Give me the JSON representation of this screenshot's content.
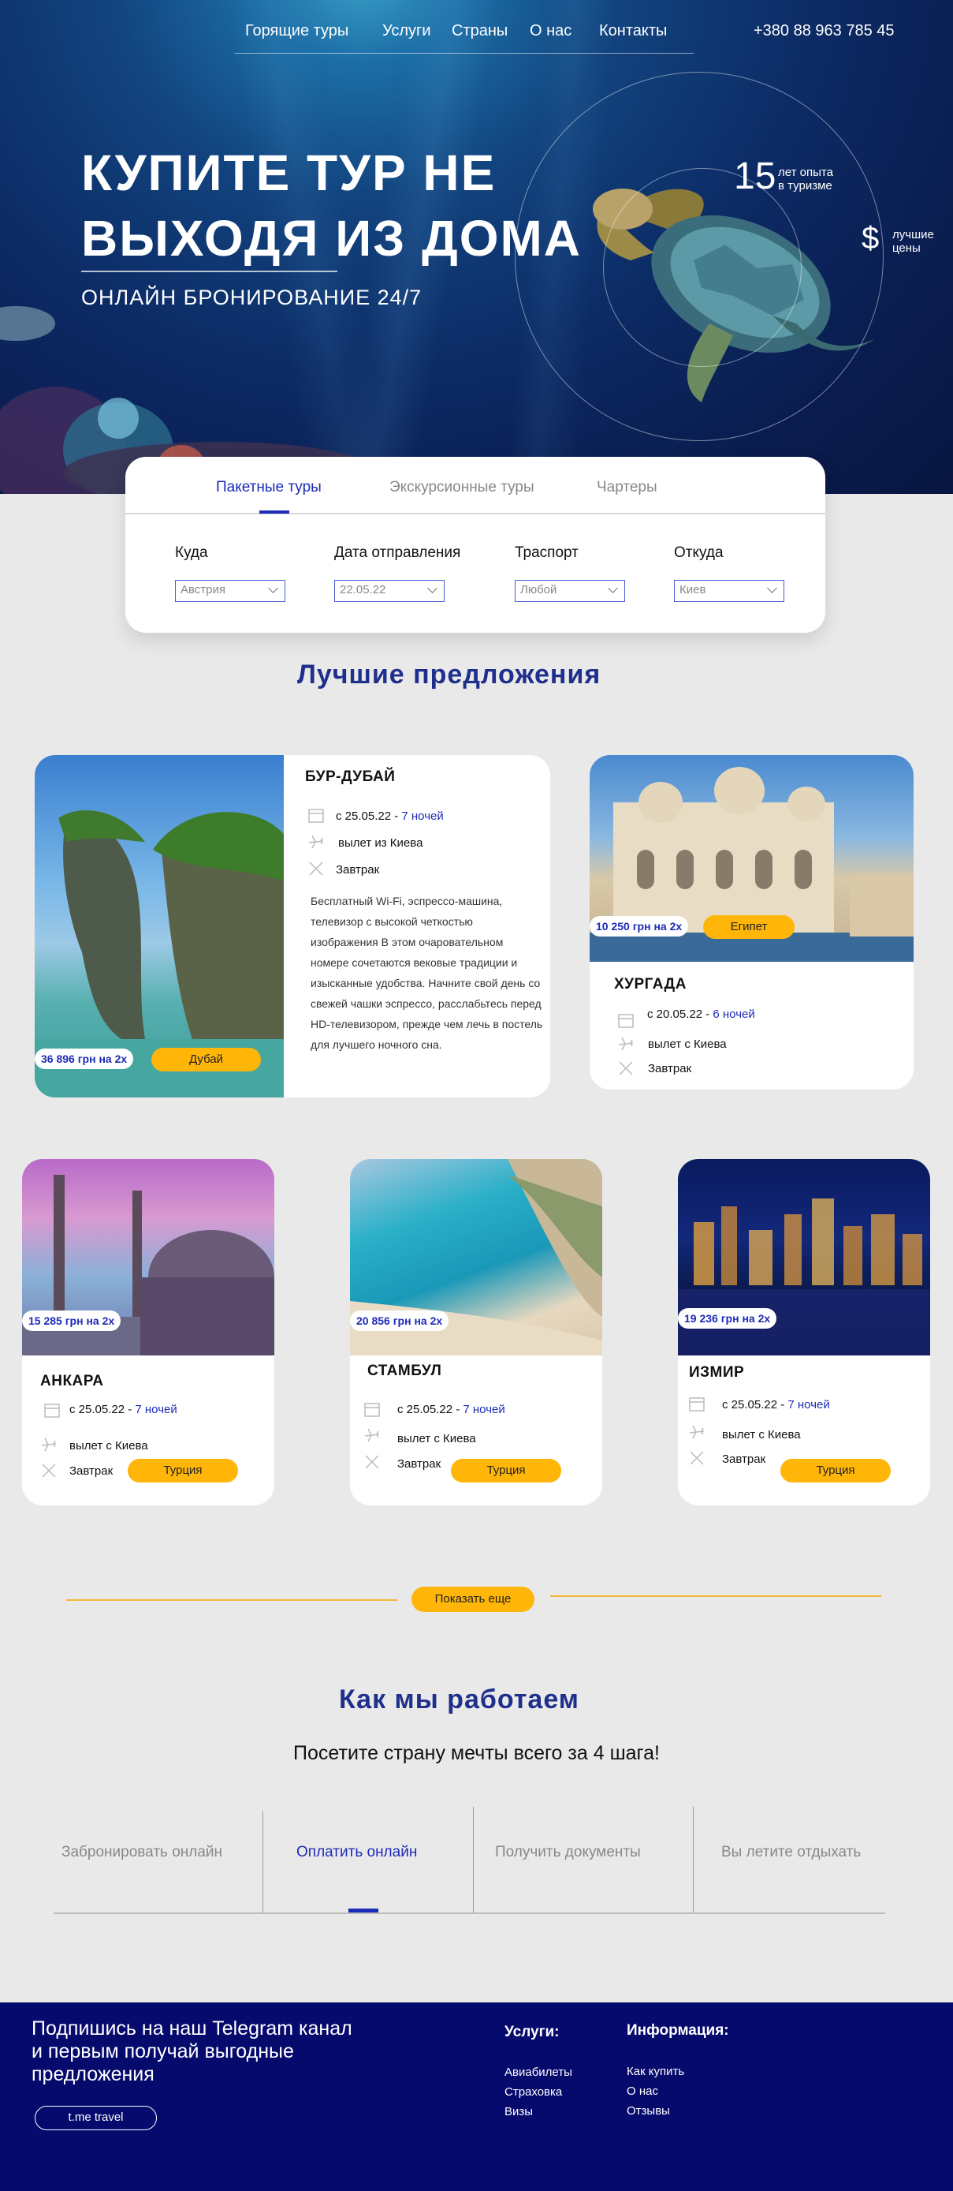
{
  "nav": {
    "items": [
      "Горящие туры",
      "Услуги",
      "Страны",
      "О нас",
      "Контакты"
    ],
    "phone": "+380 88 963 785 45"
  },
  "hero": {
    "title_line1": "КУПИТЕ ТУР НЕ",
    "title_line2": "ВЫХОДЯ ИЗ ДОМА",
    "subtitle": "ОНЛАЙН БРОНИРОВАНИЕ 24/7",
    "years_number": "15",
    "years_line1": "лет опыта",
    "years_line2": "в туризме",
    "dollar": "$",
    "price_line1": "лучшие",
    "price_line2": "цены"
  },
  "search": {
    "tabs": [
      "Пакетные туры",
      "Экскурсионные туры",
      "Чартеры"
    ],
    "active_tab": "Пакетные туры",
    "fields": [
      {
        "label": "Куда",
        "value": "Австрия"
      },
      {
        "label": "Дата отправления",
        "value": "22.05.22"
      },
      {
        "label": "Траспорт",
        "value": "Любой"
      },
      {
        "label": "Откуда",
        "value": "Киев"
      }
    ]
  },
  "offers": {
    "title": "Лучшие предложения",
    "featured": {
      "title": "БУР-ДУБАЙ",
      "date": "с 25.05.22 -",
      "nights": "7 ночей",
      "departure": "вылет из Киева",
      "meal": "Завтрак",
      "description": "Бесплатный Wi-Fi, эспрессо-машина, телевизор с высокой четкостью изображения В этом очаровательном номере сочетаются вековые традиции и изысканные удобства. Начните свой день со свежей чашки эспрессо, расслабьтесь перед HD-телевизором, прежде чем лечь в постель для лучшего ночного сна.",
      "price": "36 896 грн на 2х",
      "country": "Дубай"
    },
    "hurghada": {
      "title": "ХУРГАДА",
      "date": "с 20.05.22 -",
      "nights": "6 ночей",
      "departure": "вылет с Киева",
      "meal": "Завтрак",
      "price": "10 250 грн на 2х",
      "country": "Египет"
    },
    "cards": [
      {
        "title": "АНКАРА",
        "date": "с 25.05.22 -",
        "nights": "7 ночей",
        "departure": "вылет с Киева",
        "meal": "Завтрак",
        "price": "15 285 грн на 2х",
        "country": "Турция"
      },
      {
        "title": "СТАМБУЛ",
        "date": "с 25.05.22 -",
        "nights": "7 ночей",
        "departure": "вылет с Киева",
        "meal": "Завтрак",
        "price": "20 856 грн на 2х",
        "country": "Турция"
      },
      {
        "title": "ИЗМИР",
        "date": "с 25.05.22 -",
        "nights": "7 ночей",
        "departure": "вылет с Киева",
        "meal": "Завтрак",
        "price": "19 236 грн на 2х",
        "country": "Турция"
      }
    ],
    "more_button": "Показать еще"
  },
  "how": {
    "title": "Как мы работаем",
    "subtitle": "Посетите страну мечты всего за 4 шага!",
    "steps": [
      "Забронировать онлайн",
      "Оплатить онлайн",
      "Получить документы",
      "Вы летите отдыхать"
    ],
    "active_step": "Оплатить онлайн"
  },
  "footer": {
    "subscribe": "Подпишись на наш  Telegram канал и первым получай выгодные предложения",
    "telegram_button": "t.me travel",
    "services_title": "Услуги:",
    "services": [
      "Авиабилеты",
      "Страховка",
      "Визы"
    ],
    "info_title": "Информация:",
    "info": [
      "Как купить",
      "О нас",
      "Отзывы"
    ]
  },
  "colors": {
    "accent_blue": "#1c2bb7",
    "heading_blue": "#1f2f8c",
    "yellow": "#ffb608",
    "footer_bg": "#050a6c"
  }
}
